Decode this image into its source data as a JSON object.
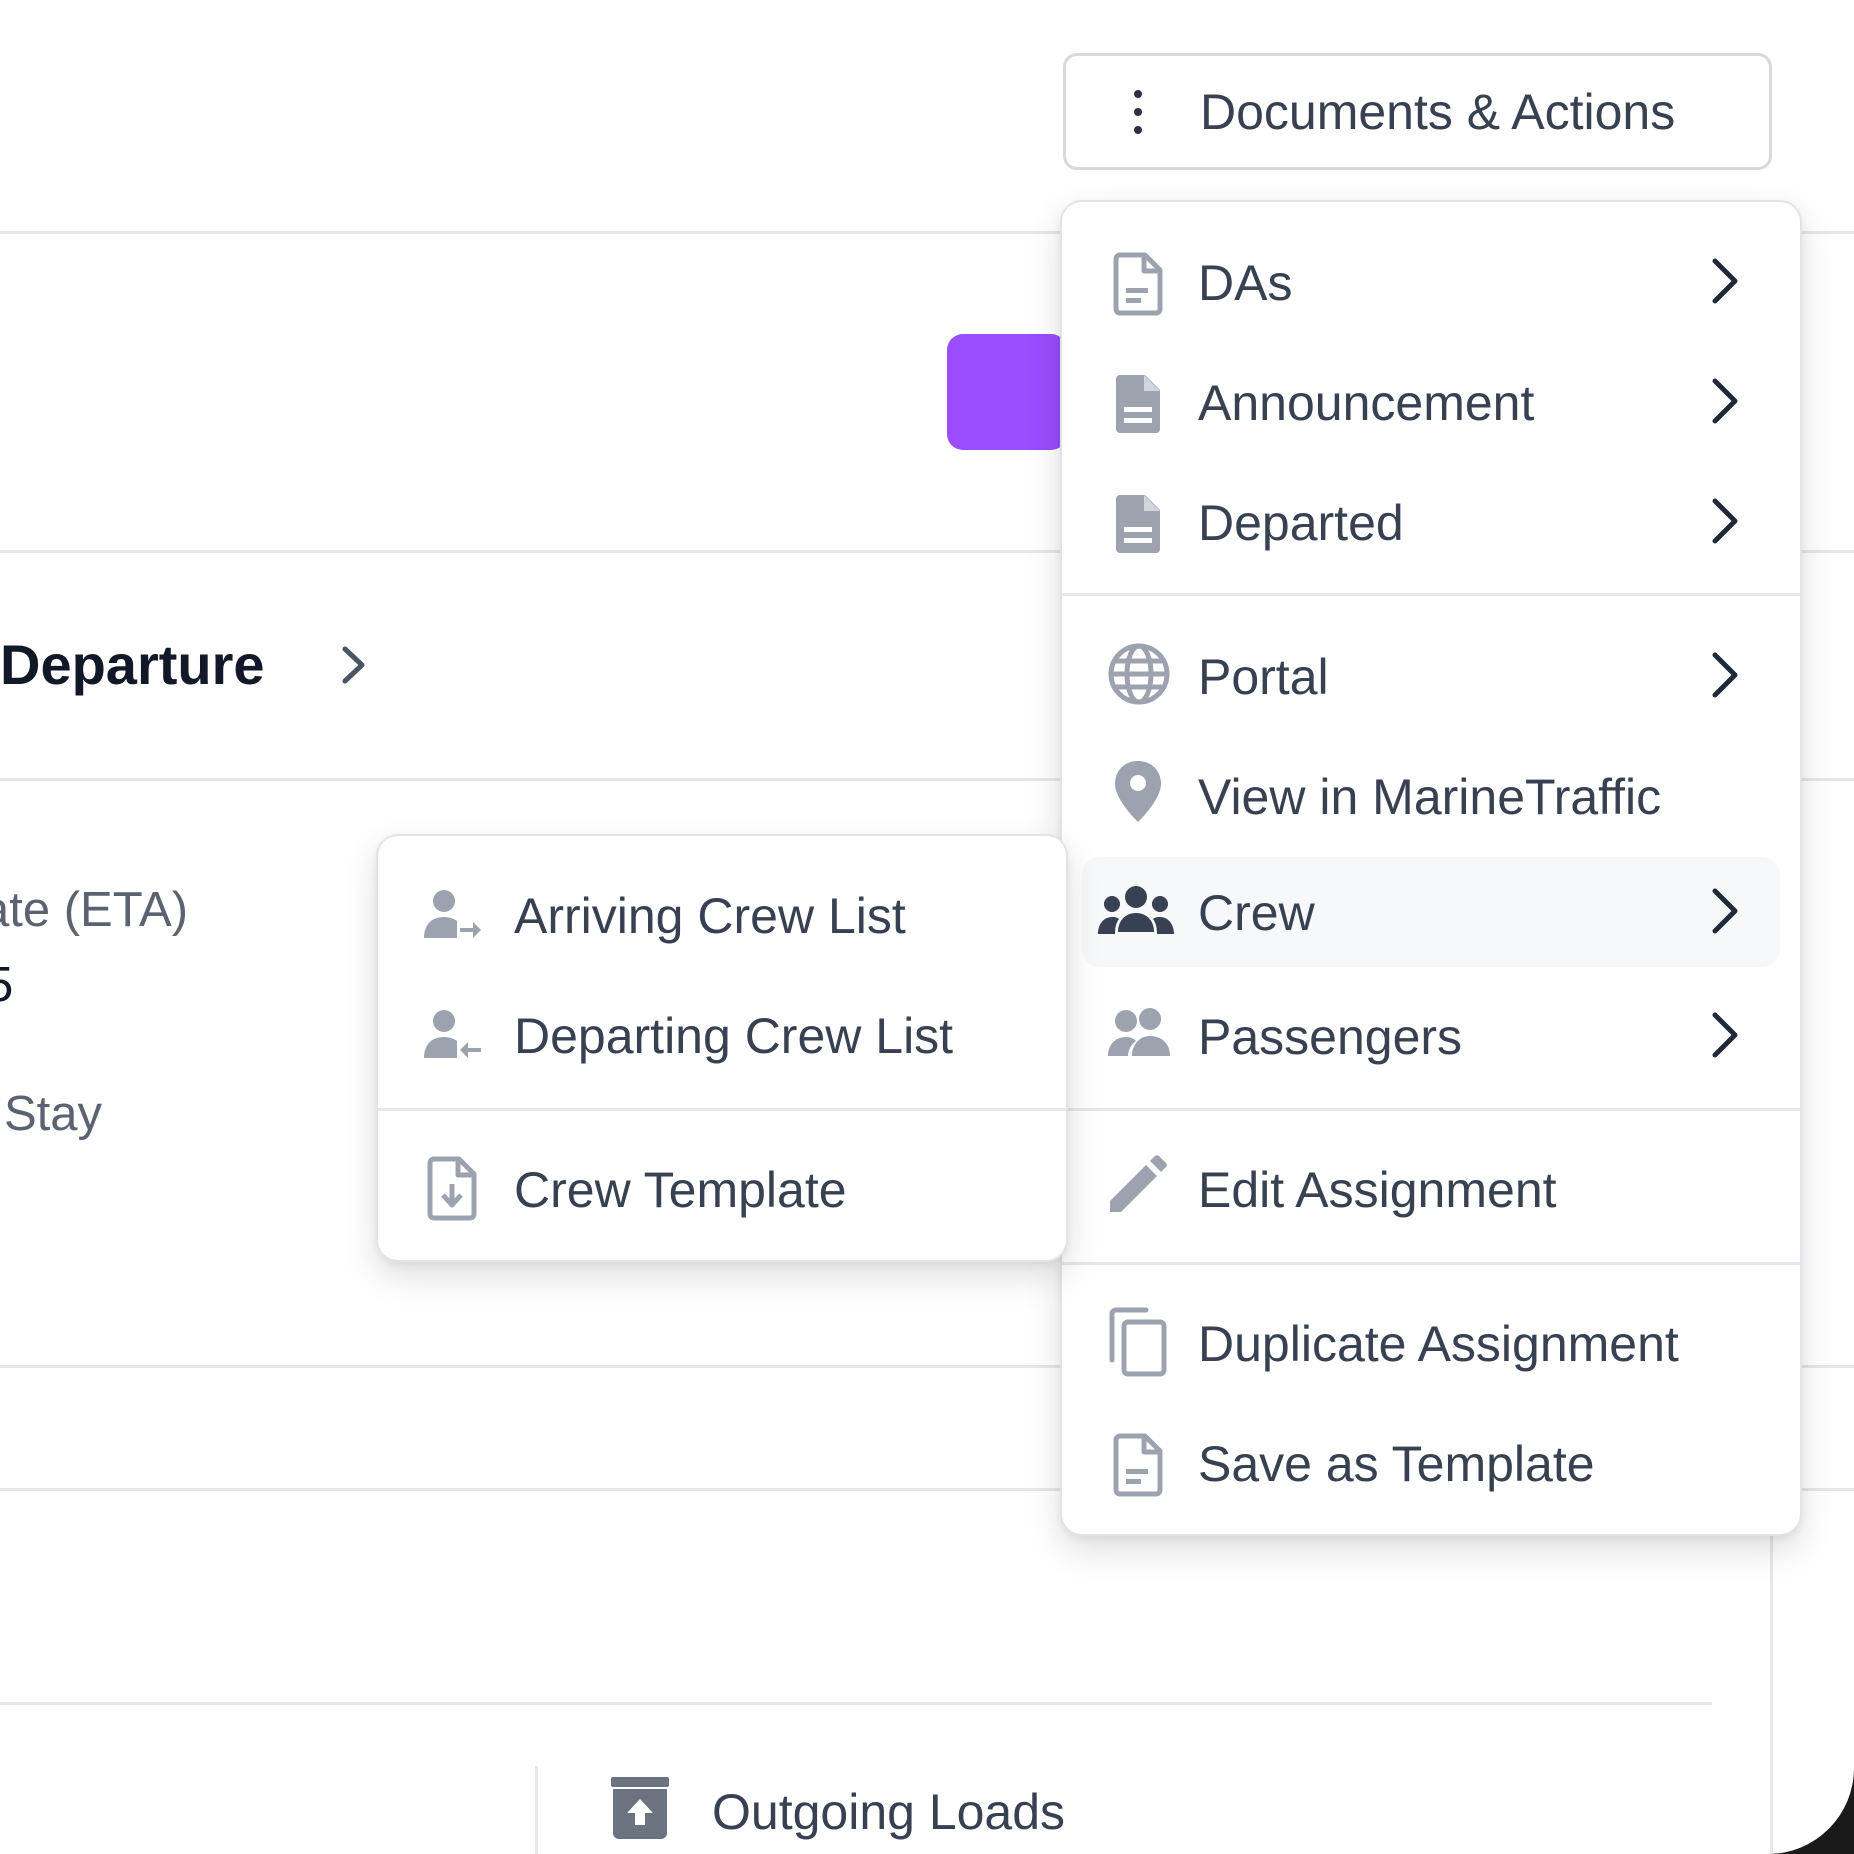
{
  "header": {
    "actions_button_label": "Documents & Actions"
  },
  "background": {
    "section_title": "Departure",
    "eta_label": "ate (ETA)",
    "eta_value": "5",
    "stay_label": "Stay",
    "outgoing_loads_label": "Outgoing Loads"
  },
  "menu": {
    "items": [
      {
        "label": "DAs",
        "icon": "document-icon",
        "has_submenu": true
      },
      {
        "label": "Announcement",
        "icon": "document-filled-icon",
        "has_submenu": true
      },
      {
        "label": "Departed",
        "icon": "document-filled-icon",
        "has_submenu": true
      },
      {
        "label": "Portal",
        "icon": "globe-icon",
        "has_submenu": true
      },
      {
        "label": "View in MarineTraffic",
        "icon": "map-pin-icon",
        "has_submenu": false
      },
      {
        "label": "Crew",
        "icon": "crew-icon",
        "has_submenu": true,
        "highlighted": true
      },
      {
        "label": "Passengers",
        "icon": "passengers-icon",
        "has_submenu": true
      },
      {
        "label": "Edit Assignment",
        "icon": "pencil-icon",
        "has_submenu": false
      },
      {
        "label": "Duplicate Assignment",
        "icon": "copy-icon",
        "has_submenu": false
      },
      {
        "label": "Save as Template",
        "icon": "document-icon",
        "has_submenu": false
      }
    ]
  },
  "crew_submenu": {
    "items": [
      {
        "label": "Arriving Crew List",
        "icon": "person-arrive-icon"
      },
      {
        "label": "Departing Crew List",
        "icon": "person-depart-icon"
      },
      {
        "label": "Crew Template",
        "icon": "file-download-icon"
      }
    ]
  },
  "colors": {
    "accent": "#9b4dff",
    "text": "#374151",
    "icon": "#9ca3af",
    "icon_active": "#374151"
  }
}
